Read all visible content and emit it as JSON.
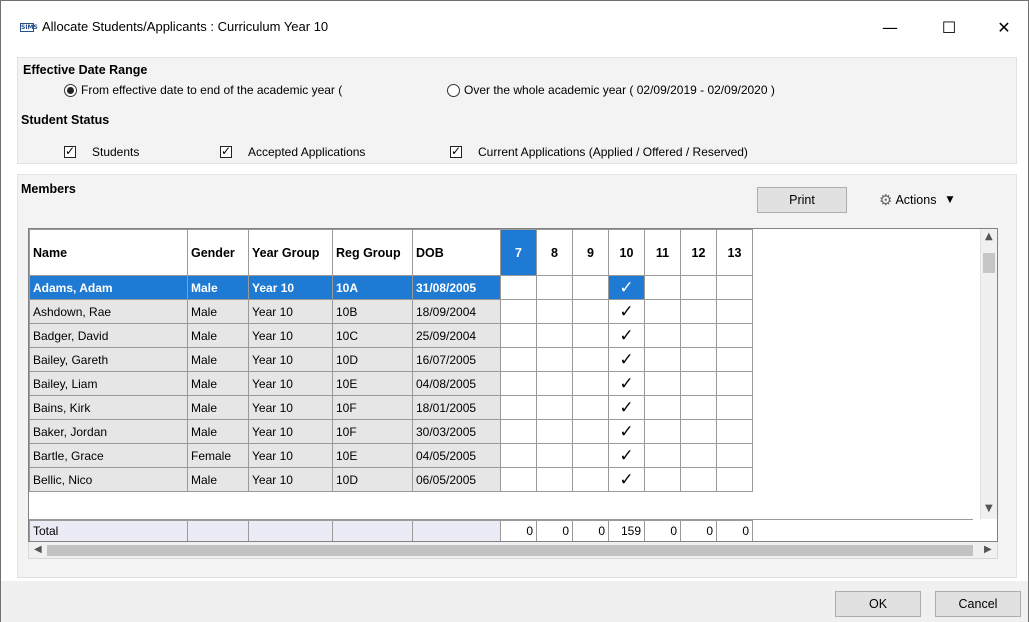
{
  "window": {
    "app_icon_text": "SIMS",
    "title": "Allocate Students/Applicants : Curriculum Year 10",
    "minimize": "—",
    "maximize": "☐",
    "close": "✕"
  },
  "date_range": {
    "title": "Effective Date Range",
    "option1": "From effective date to end of the academic year (",
    "option2": "Over the whole academic year ( 02/09/2019 - 02/09/2020 )",
    "selected": "option1"
  },
  "student_status": {
    "title": "Student Status",
    "students": "Students",
    "accepted": "Accepted Applications",
    "current": "Current Applications (Applied / Offered / Reserved)"
  },
  "members": {
    "title": "Members",
    "print_label": "Print",
    "actions_label": "Actions",
    "columns": [
      "Name",
      "Gender",
      "Year Group",
      "Reg Group",
      "DOB"
    ],
    "year_columns": [
      "7",
      "8",
      "9",
      "10",
      "11",
      "12",
      "13"
    ],
    "active_year": "7",
    "rows": [
      {
        "name": "Adams, Adam",
        "gender": "Male",
        "year": "Year 10",
        "reg": "10A",
        "dob": "31/08/2005",
        "selected": true
      },
      {
        "name": "Ashdown, Rae",
        "gender": "Male",
        "year": "Year 10",
        "reg": "10B",
        "dob": "18/09/2004"
      },
      {
        "name": "Badger, David",
        "gender": "Male",
        "year": "Year 10",
        "reg": "10C",
        "dob": "25/09/2004"
      },
      {
        "name": "Bailey, Gareth",
        "gender": "Male",
        "year": "Year 10",
        "reg": "10D",
        "dob": "16/07/2005"
      },
      {
        "name": "Bailey, Liam",
        "gender": "Male",
        "year": "Year 10",
        "reg": "10E",
        "dob": "04/08/2005"
      },
      {
        "name": "Bains, Kirk",
        "gender": "Male",
        "year": "Year 10",
        "reg": "10F",
        "dob": "18/01/2005"
      },
      {
        "name": "Baker, Jordan",
        "gender": "Male",
        "year": "Year 10",
        "reg": "10F",
        "dob": "30/03/2005"
      },
      {
        "name": "Bartle, Grace",
        "gender": "Female",
        "year": "Year 10",
        "reg": "10E",
        "dob": "04/05/2005"
      },
      {
        "name": "Bellic, Nico",
        "gender": "Male",
        "year": "Year 10",
        "reg": "10D",
        "dob": "06/05/2005"
      }
    ],
    "tick": "✓",
    "total_label": "Total",
    "totals": [
      "0",
      "0",
      "0",
      "159",
      "0",
      "0",
      "0"
    ]
  },
  "footer": {
    "ok": "OK",
    "cancel": "Cancel"
  }
}
